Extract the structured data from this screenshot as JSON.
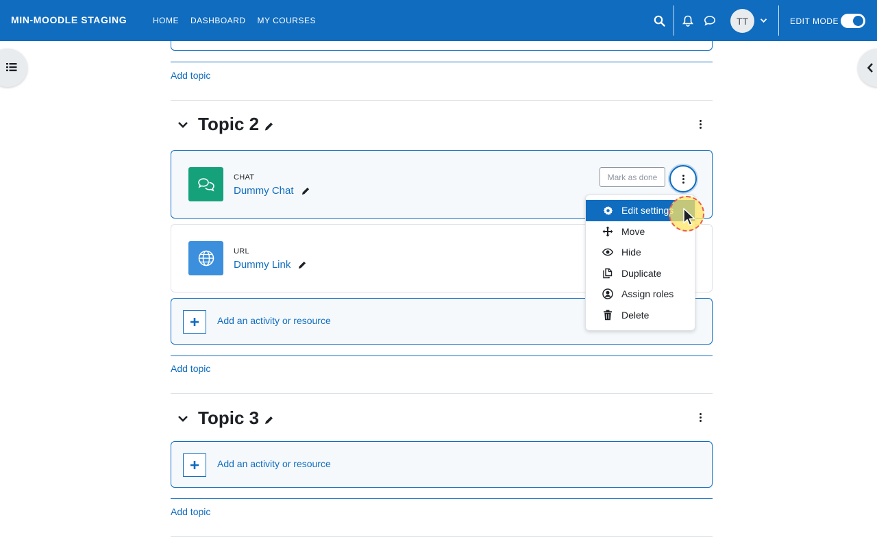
{
  "navbar": {
    "brand": "MIN-MOODLE STAGING",
    "links": [
      "HOME",
      "DASHBOARD",
      "MY COURSES"
    ],
    "avatar_initials": "TT",
    "edit_mode_label": "EDIT MODE",
    "edit_mode_on": true,
    "icons": [
      "search-icon",
      "bell-icon",
      "chat-bubble-icon",
      "chevron-down-icon"
    ]
  },
  "sections": {
    "add_topic_label": "Add topic",
    "topic2": {
      "title": "Topic 2",
      "activities": [
        {
          "type": "CHAT",
          "name": "Dummy Chat",
          "icon": "chat-icon",
          "color": "#15a17a",
          "completion_button": "Mark as done"
        },
        {
          "type": "URL",
          "name": "Dummy Link",
          "icon": "globe-icon",
          "color": "#3b8fdc"
        }
      ],
      "add_activity_label": "Add an activity or resource"
    },
    "topic3": {
      "title": "Topic 3",
      "add_activity_label": "Add an activity or resource"
    }
  },
  "activity_menu": {
    "items": [
      {
        "label": "Edit settings",
        "icon": "gear-icon",
        "active": true
      },
      {
        "label": "Move",
        "icon": "move-arrows-icon"
      },
      {
        "label": "Hide",
        "icon": "eye-icon"
      },
      {
        "label": "Duplicate",
        "icon": "copy-icon"
      },
      {
        "label": "Assign roles",
        "icon": "user-circle-icon"
      },
      {
        "label": "Delete",
        "icon": "trash-icon"
      }
    ]
  },
  "colors": {
    "primary": "#0f6cbf",
    "chat_icon_bg": "#15a17a",
    "url_icon_bg": "#3b8fdc"
  }
}
